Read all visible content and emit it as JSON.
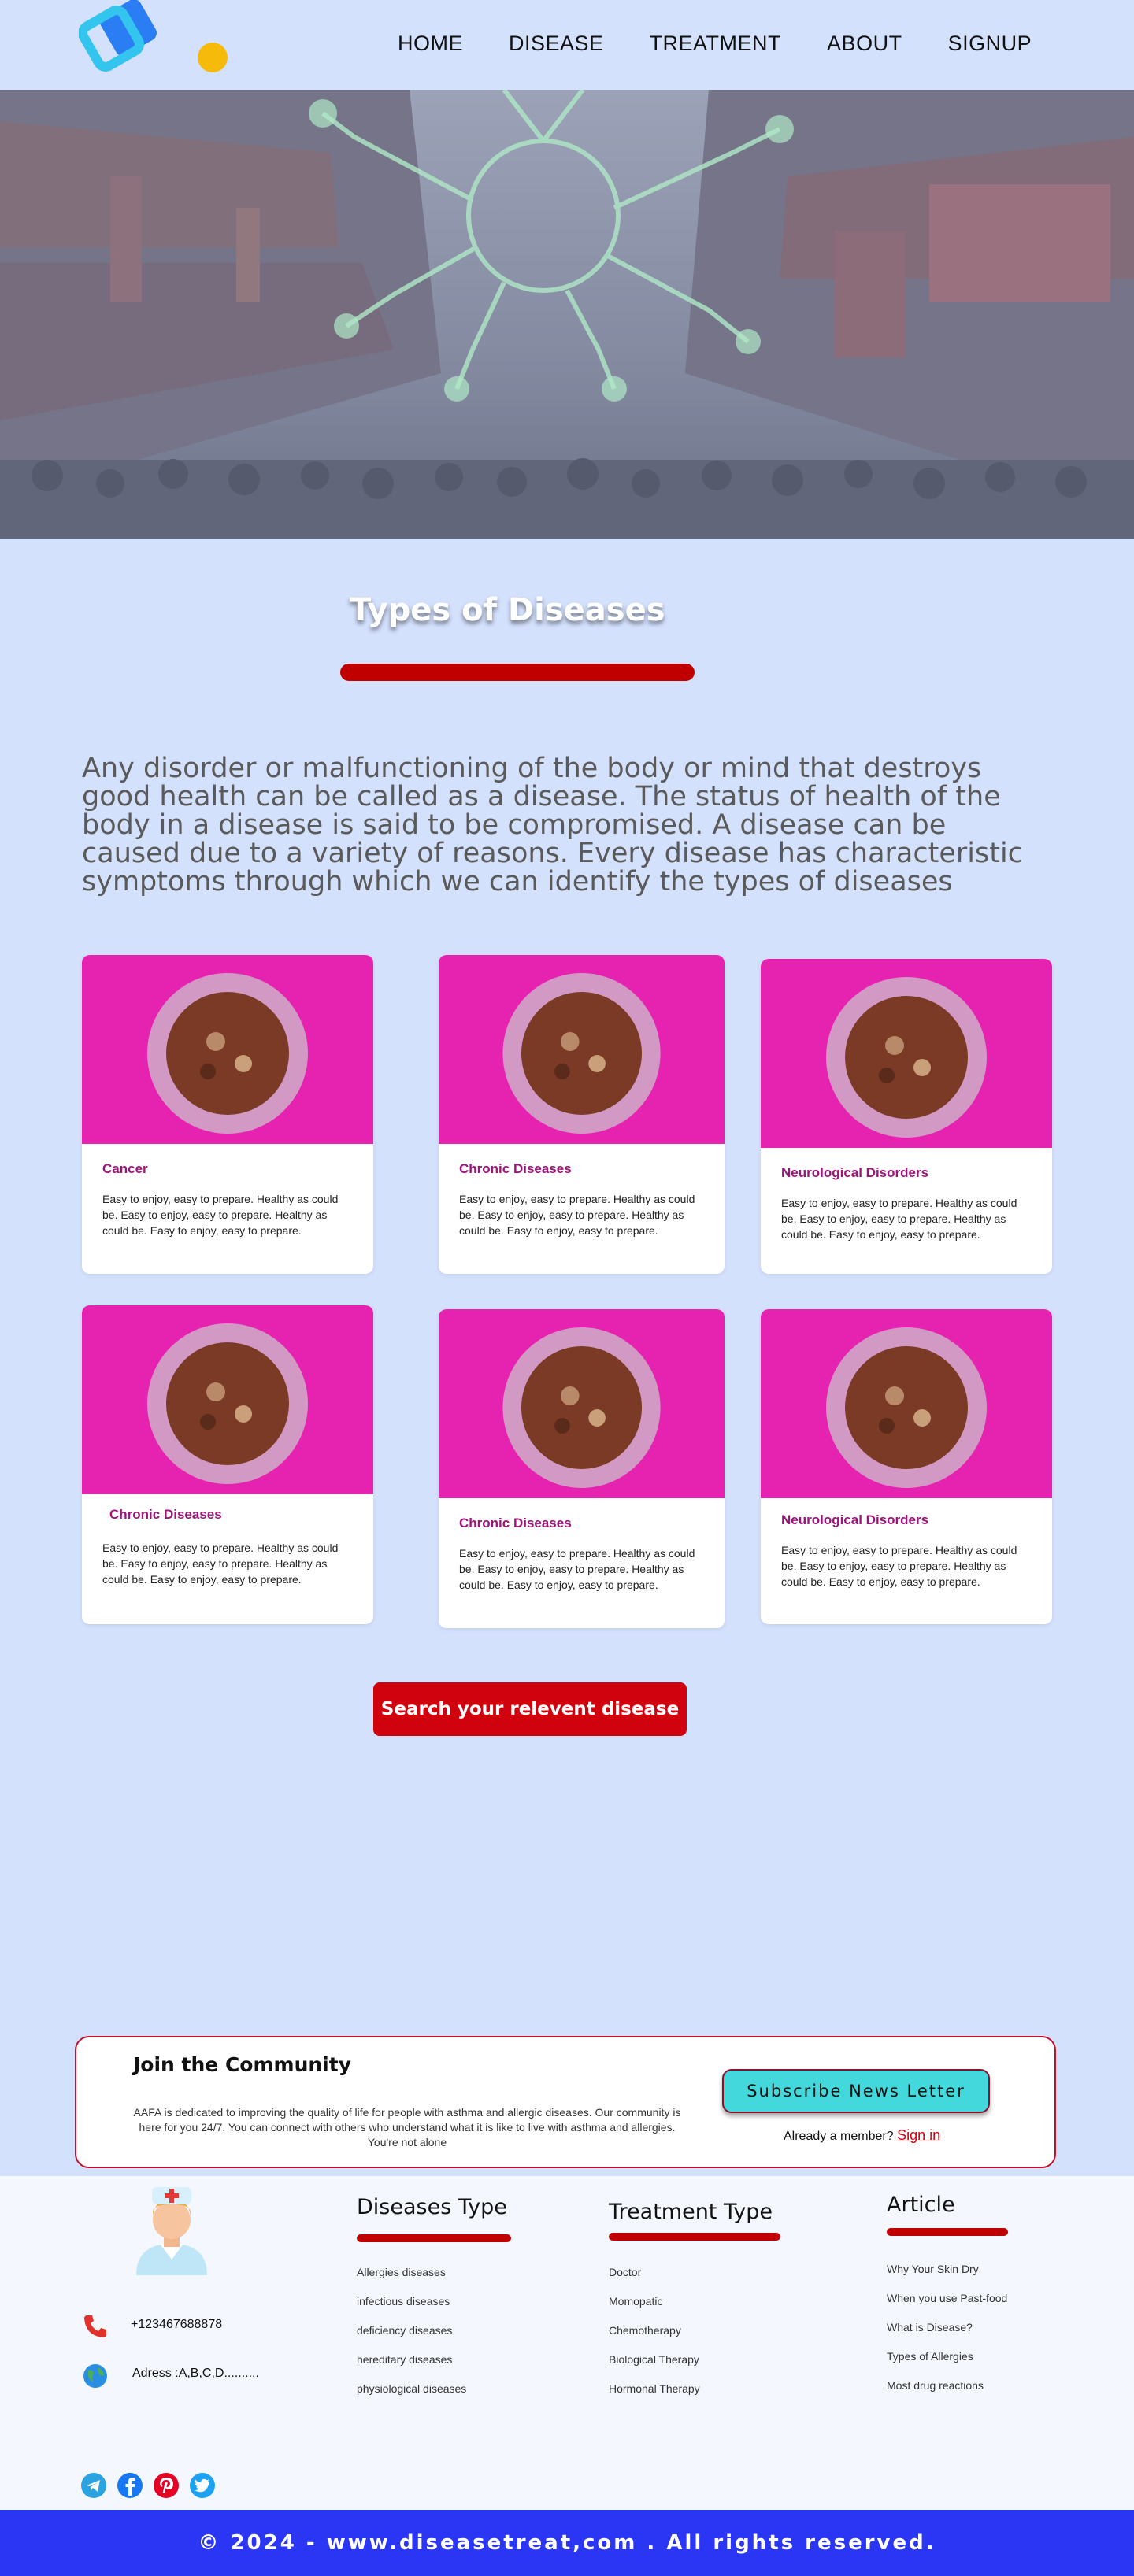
{
  "nav": {
    "items": [
      {
        "label": "HOME"
      },
      {
        "label": "DISEASE"
      },
      {
        "label": "TREATMENT"
      },
      {
        "label": "ABOUT"
      },
      {
        "label": "SIGNUP"
      }
    ]
  },
  "types": {
    "title": "Types of Diseases",
    "intro": "Any disorder or malfunctioning of the body or mind that destroys good health can be called as a disease. The status of health of the body in a disease is said to be compromised. A disease can be caused due to a variety of reasons. Every disease has characteristic symptoms through which we can identify the types of diseases"
  },
  "cards": [
    {
      "title": "Cancer",
      "text": "Easy to enjoy, easy to prepare. Healthy as could be. Easy to enjoy, easy to prepare. Healthy as could be. Easy to enjoy, easy to prepare."
    },
    {
      "title": "Chronic Diseases",
      "text": "Easy to enjoy, easy to prepare. Healthy as could be. Easy to enjoy, easy to prepare. Healthy as could be. Easy to enjoy, easy to prepare."
    },
    {
      "title": "Neurological Disorders",
      "text": "Easy to enjoy, easy to prepare. Healthy as could be. Easy to enjoy, easy to prepare. Healthy as could be. Easy to enjoy, easy to prepare."
    },
    {
      "title": "Chronic Diseases",
      "text": "Easy to enjoy, easy to prepare. Healthy as could be. Easy to enjoy, easy to prepare. Healthy as could be. Easy to enjoy, easy to prepare."
    },
    {
      "title": "Chronic Diseases",
      "text": "Easy to enjoy, easy to prepare. Healthy as could be. Easy to enjoy, easy to prepare. Healthy as could be. Easy to enjoy, easy to prepare."
    },
    {
      "title": "Neurological Disorders",
      "text": "Easy to enjoy, easy to prepare. Healthy as could be. Easy to enjoy, easy to prepare. Healthy as could be. Easy to enjoy, easy to prepare."
    }
  ],
  "search_button": "Search your relevent disease",
  "community": {
    "title": "Join the Community",
    "text": "AAFA is dedicated to improving the quality of life for people with asthma and allergic diseases. Our community is here for you 24/7. You can connect with others who understand what it is like to live with asthma and allergies. You're not alone",
    "subscribe": "Subscribe News Letter",
    "member_text": "Already a member?",
    "signin": "Sign in"
  },
  "footer": {
    "phone": "+123467688878",
    "address": "Adress :A,B,C,D..........",
    "diseases": {
      "title": "Diseases Type",
      "items": [
        "Allergies  diseases",
        "infectious diseases",
        "deficiency diseases",
        "hereditary diseases",
        "physiological diseases"
      ]
    },
    "treatment": {
      "title": "Treatment Type",
      "items": [
        "Doctor",
        "Momopatic",
        "Chemotherapy",
        "Biological Therapy",
        "Hormonal Therapy"
      ]
    },
    "article": {
      "title": "Article",
      "items": [
        "Why Your Skin Dry",
        "When you use Past-food",
        "What is Disease?",
        "Types of Allergies",
        "Most drug reactions"
      ]
    },
    "social_icons": [
      "telegram-icon",
      "facebook-icon",
      "pinterest-icon",
      "twitter-icon"
    ]
  },
  "copyright": "© 2024 - www.diseasetreat,com . All rights reserved.",
  "colors": {
    "background": "#d4e1fd",
    "accent_red": "#c00000",
    "card_title": "#a0137a",
    "subscribe": "#43d8db",
    "copyright_bar": "#2a36f4"
  }
}
